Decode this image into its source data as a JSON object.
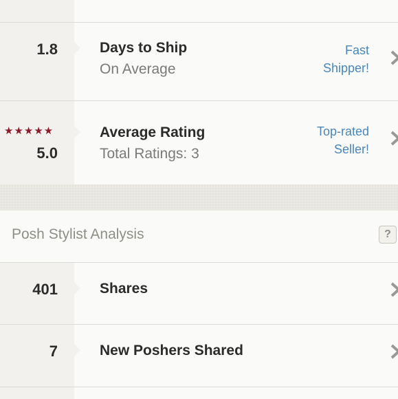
{
  "stats": [
    {
      "value": "1.8",
      "title": "Days to Ship",
      "subtitle": "On Average",
      "badge_line1": "Fast",
      "badge_line2": "Shipper!"
    },
    {
      "stars": "★★★★★",
      "value": "5.0",
      "title": "Average Rating",
      "subtitle": "Total Ratings: 3",
      "badge_line1": "Top-rated",
      "badge_line2": "Seller!"
    }
  ],
  "section": {
    "title": "Posh Stylist Analysis",
    "help": "?"
  },
  "analysis": [
    {
      "value": "401",
      "title": "Shares"
    },
    {
      "value": "7",
      "title": "New Poshers Shared"
    }
  ],
  "colors": {
    "accent_link": "#4a86b8",
    "star": "#8c1c2a",
    "text_dark": "#2b2b2b"
  }
}
